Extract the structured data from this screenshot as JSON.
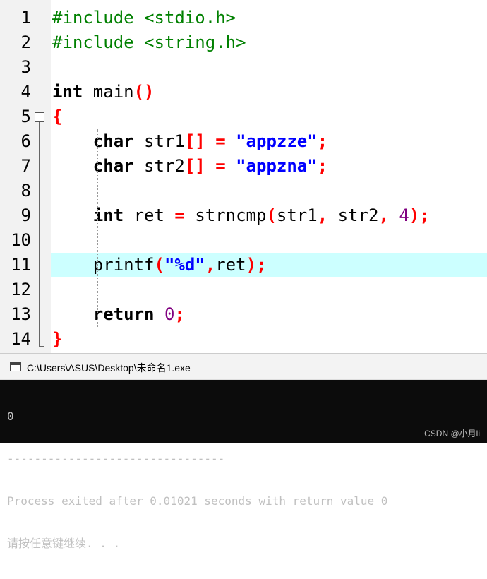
{
  "editor": {
    "line_numbers": [
      "1",
      "2",
      "3",
      "4",
      "5",
      "6",
      "7",
      "8",
      "9",
      "10",
      "11",
      "12",
      "13",
      "14"
    ],
    "lines": [
      {
        "tokens": [
          {
            "t": "#include <stdio.h>",
            "c": "pre"
          }
        ]
      },
      {
        "tokens": [
          {
            "t": "#include <string.h>",
            "c": "pre"
          }
        ]
      },
      {
        "tokens": []
      },
      {
        "tokens": [
          {
            "t": "int",
            "c": "kw"
          },
          {
            "t": " main",
            "c": ""
          },
          {
            "t": "()",
            "c": "pun"
          }
        ]
      },
      {
        "tokens": [
          {
            "t": "{",
            "c": "pun"
          }
        ]
      },
      {
        "tokens": [
          {
            "t": "    ",
            "c": ""
          },
          {
            "t": "char",
            "c": "kw"
          },
          {
            "t": " str1",
            "c": ""
          },
          {
            "t": "[]",
            "c": "pun"
          },
          {
            "t": " ",
            "c": ""
          },
          {
            "t": "=",
            "c": "pun"
          },
          {
            "t": " ",
            "c": ""
          },
          {
            "t": "\"appzze\"",
            "c": "str"
          },
          {
            "t": ";",
            "c": "pun"
          }
        ]
      },
      {
        "tokens": [
          {
            "t": "    ",
            "c": ""
          },
          {
            "t": "char",
            "c": "kw"
          },
          {
            "t": " str2",
            "c": ""
          },
          {
            "t": "[]",
            "c": "pun"
          },
          {
            "t": " ",
            "c": ""
          },
          {
            "t": "=",
            "c": "pun"
          },
          {
            "t": " ",
            "c": ""
          },
          {
            "t": "\"appzna\"",
            "c": "str"
          },
          {
            "t": ";",
            "c": "pun"
          }
        ]
      },
      {
        "tokens": []
      },
      {
        "tokens": [
          {
            "t": "    ",
            "c": ""
          },
          {
            "t": "int",
            "c": "kw"
          },
          {
            "t": " ret ",
            "c": ""
          },
          {
            "t": "=",
            "c": "pun"
          },
          {
            "t": " strncmp",
            "c": ""
          },
          {
            "t": "(",
            "c": "pun"
          },
          {
            "t": "str1",
            "c": ""
          },
          {
            "t": ",",
            "c": "pun"
          },
          {
            "t": " str2",
            "c": ""
          },
          {
            "t": ",",
            "c": "pun"
          },
          {
            "t": " ",
            "c": ""
          },
          {
            "t": "4",
            "c": "num"
          },
          {
            "t": ");",
            "c": "pun"
          }
        ]
      },
      {
        "tokens": []
      },
      {
        "tokens": [
          {
            "t": "    ",
            "c": ""
          },
          {
            "t": "printf",
            "c": ""
          },
          {
            "t": "(",
            "c": "pun"
          },
          {
            "t": "\"%d\"",
            "c": "str"
          },
          {
            "t": ",",
            "c": "pun"
          },
          {
            "t": "ret",
            "c": ""
          },
          {
            "t": ");",
            "c": "pun"
          }
        ]
      },
      {
        "tokens": []
      },
      {
        "tokens": [
          {
            "t": "    ",
            "c": ""
          },
          {
            "t": "return",
            "c": "kw"
          },
          {
            "t": " ",
            "c": ""
          },
          {
            "t": "0",
            "c": "num"
          },
          {
            "t": ";",
            "c": "pun"
          }
        ]
      },
      {
        "tokens": [
          {
            "t": "}",
            "c": "pun"
          }
        ]
      }
    ],
    "highlighted_line": "11",
    "colors": {
      "preprocessor": "#008000",
      "string": "#0000ff",
      "number": "#800080",
      "punctuation": "#ff0000",
      "highlight": "#ccffff"
    }
  },
  "console": {
    "title": "C:\\Users\\ASUS\\Desktop\\未命名1.exe",
    "title_icon": "console-window-icon",
    "output": [
      "0",
      "--------------------------------",
      "Process exited after 0.01021 seconds with return value 0",
      "请按任意键继续. . ."
    ]
  },
  "watermark": "CSDN @小月li"
}
